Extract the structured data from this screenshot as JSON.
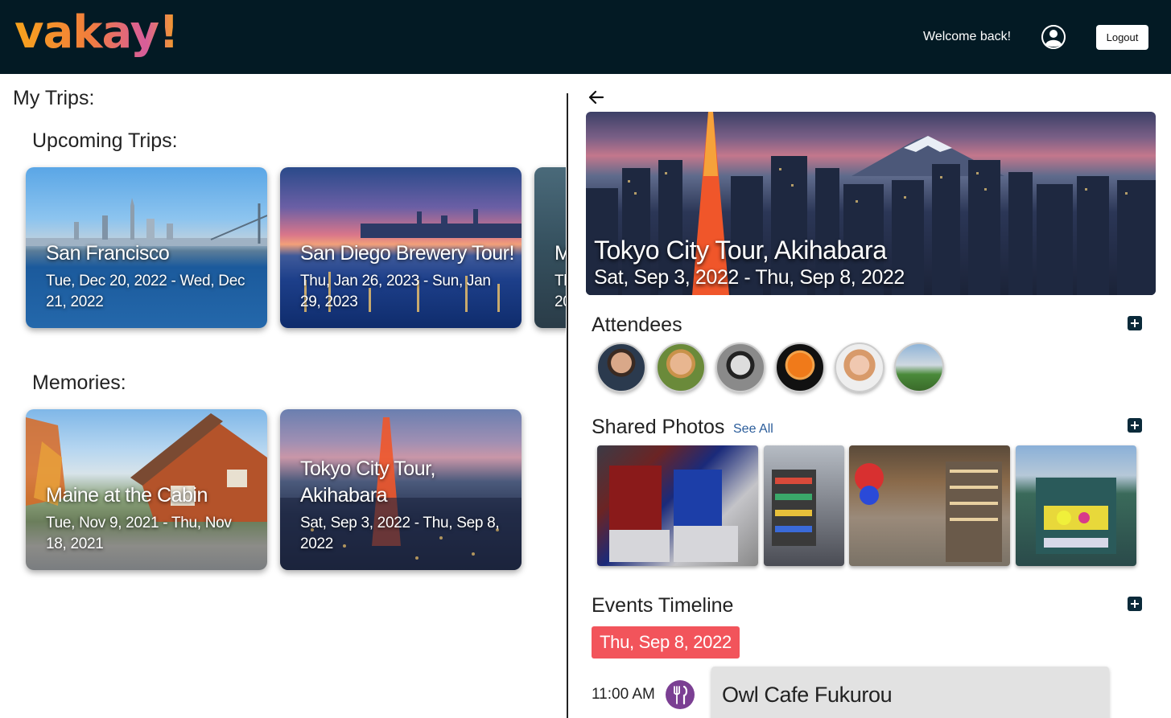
{
  "header": {
    "logo": "vakay!",
    "welcome": "Welcome back!",
    "logout_label": "Logout"
  },
  "left": {
    "my_trips": "My Trips:",
    "upcoming_title": "Upcoming Trips:",
    "upcoming": [
      {
        "title": "San Francisco",
        "dates": "Tue, Dec 20, 2022 - Wed, Dec 21, 2022"
      },
      {
        "title": "San Diego Brewery Tour!",
        "dates": "Thu, Jan 26, 2023 - Sun, Jan 29, 2023"
      },
      {
        "title": "M",
        "dates": "Th 20"
      }
    ],
    "memories_title": "Memories:",
    "memories": [
      {
        "title": "Maine at the Cabin",
        "dates": "Tue, Nov 9, 2021 - Thu, Nov 18, 2021"
      },
      {
        "title": "Tokyo City Tour, Akihabara",
        "dates": "Sat, Sep 3, 2022 - Thu, Sep 8, 2022"
      }
    ]
  },
  "detail": {
    "title": "Tokyo City Tour, Akihabara",
    "dates": "Sat, Sep 3, 2022 - Thu, Sep 8, 2022",
    "attendees_title": "Attendees",
    "shared_photos_title": "Shared Photos",
    "see_all": "See All",
    "events_title": "Events Timeline",
    "event_date": "Thu, Sep 8, 2022",
    "events": [
      {
        "time": "11:00 AM",
        "title": "Owl Cafe Fukurou",
        "icon": "fork-knife-icon"
      }
    ]
  },
  "colors": {
    "header_bg": "#031a24",
    "date_badge": "#f2545b",
    "event_icon": "#7b3f93",
    "plus_button": "#0a2a3a"
  }
}
